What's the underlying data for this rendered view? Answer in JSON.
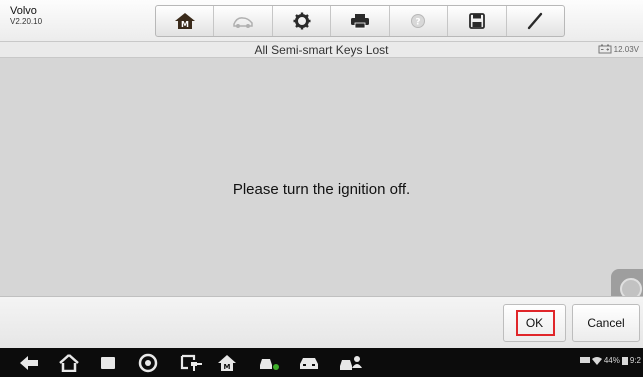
{
  "header": {
    "brand": "Volvo",
    "version": "V2.20.10",
    "toolbar": [
      {
        "icon": "home-icon"
      },
      {
        "icon": "vehicle-swap-icon"
      },
      {
        "icon": "settings-gear-icon"
      },
      {
        "icon": "printer-icon"
      },
      {
        "icon": "help-icon"
      },
      {
        "icon": "save-icon"
      },
      {
        "icon": "edit-icon"
      }
    ]
  },
  "title_bar": {
    "title": "All Semi-smart Keys Lost",
    "voltage": "12.03V"
  },
  "main": {
    "message": "Please turn the ignition off."
  },
  "footer": {
    "ok_label": "OK",
    "cancel_label": "Cancel",
    "highlight_color": "#e0262a"
  },
  "system_bar": {
    "battery": "44%",
    "time": "9:2"
  }
}
